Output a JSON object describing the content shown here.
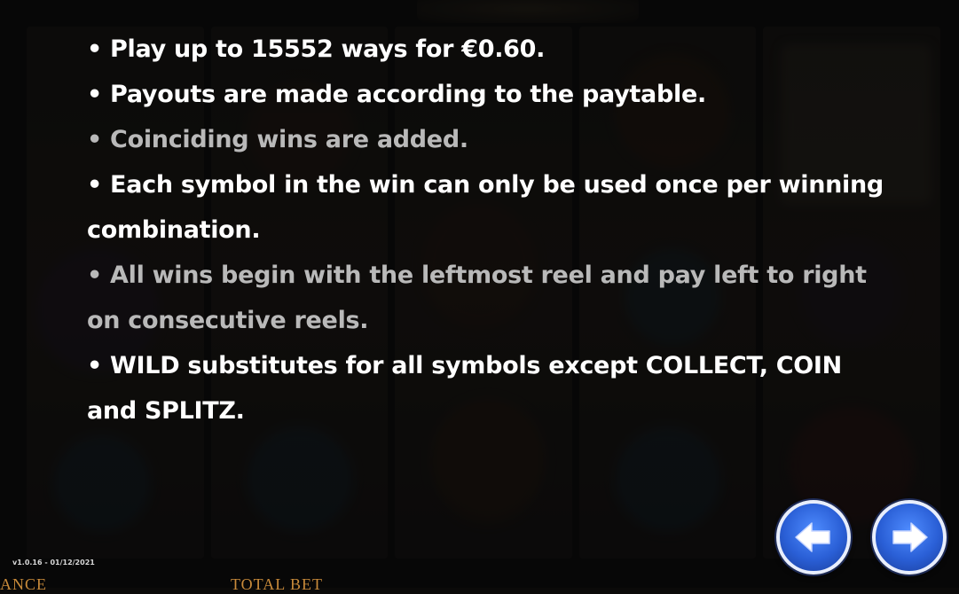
{
  "rules": [
    {
      "text": "• Play up to 15552 ways for €0.60.",
      "dim": false
    },
    {
      "text": "• Payouts are made according to the paytable.",
      "dim": false
    },
    {
      "text": "• Coinciding wins are added.",
      "dim": true
    },
    {
      "text": "• Each symbol in the win can only be used once per winning combination.",
      "dim": false
    },
    {
      "text": "• All wins begin with the leftmost reel and pay left to right on consecutive reels.",
      "dim": true
    },
    {
      "text": "• WILD substitutes for all symbols except COLLECT, COIN and SPLITZ.",
      "dim": false
    }
  ],
  "footer": {
    "version": "v1.0.16 - 01/12/2021",
    "balance_label": "ANCE",
    "total_bet_label": "TOTAL BET"
  },
  "nav": {
    "prev_icon": "arrow-left-icon",
    "next_icon": "arrow-right-icon"
  },
  "colors": {
    "button_blue": "#2a5fd6",
    "label_orange": "#c88a3a"
  }
}
